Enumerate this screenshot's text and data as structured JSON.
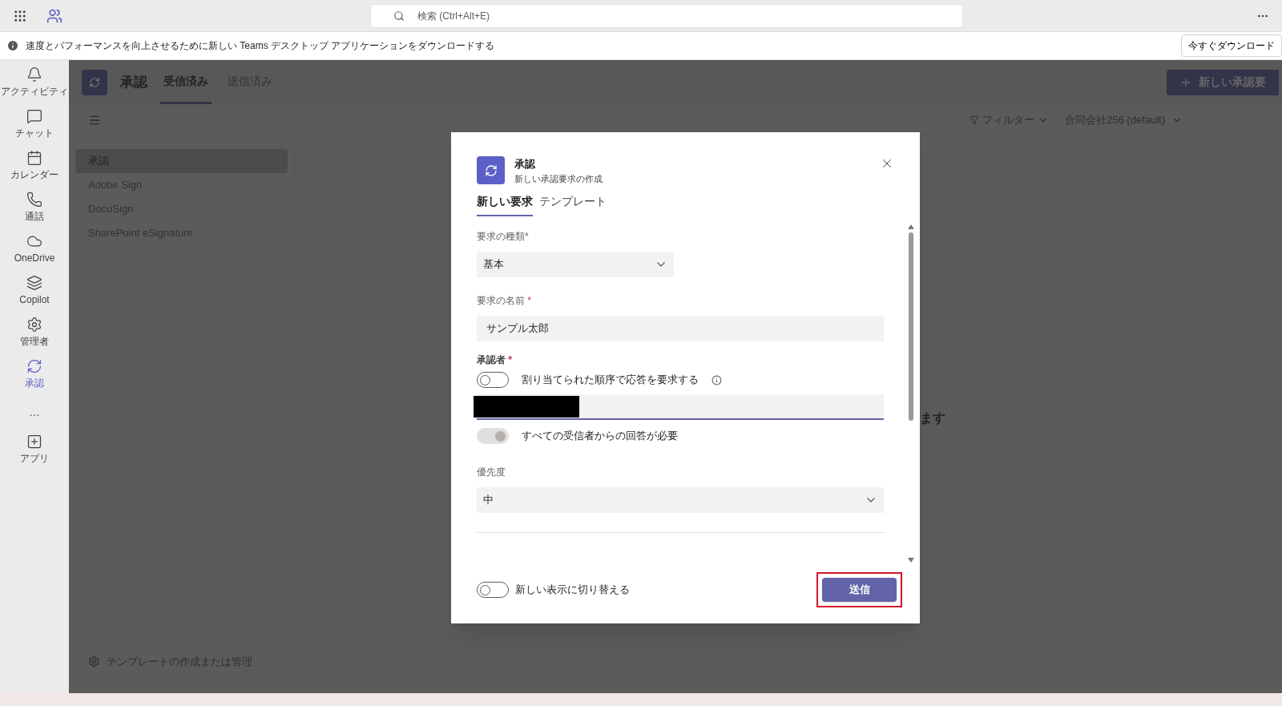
{
  "topbar": {
    "search": {
      "placeholder": "検索 (Ctrl+Alt+E)"
    }
  },
  "banner": {
    "text": "速度とパフォーマンスを向上させるために新しい Teams デスクトップ アプリケーションをダウンロードする",
    "button": "今すぐダウンロード"
  },
  "rail": [
    {
      "label": "アクティビティ",
      "selected": false
    },
    {
      "label": "チャット",
      "selected": false
    },
    {
      "label": "カレンダー",
      "selected": false
    },
    {
      "label": "通話",
      "selected": false
    },
    {
      "label": "OneDrive",
      "selected": false
    },
    {
      "label": "Copilot",
      "selected": false
    },
    {
      "label": "管理者",
      "selected": false
    },
    {
      "label": "承認",
      "selected": true
    },
    {
      "label": "…",
      "kind": "more",
      "selected": false
    },
    {
      "label": "アプリ",
      "selected": false
    }
  ],
  "app_header": {
    "title": "承認",
    "tabs": [
      {
        "label": "受信済み",
        "selected": true
      },
      {
        "label": "送信済み",
        "selected": false
      }
    ],
    "new_button": "新しい承認要"
  },
  "left_panel": {
    "items": [
      {
        "label": "承認",
        "selected": true
      },
      {
        "label": "Adobe Sign",
        "selected": false
      },
      {
        "label": "DocuSign",
        "selected": false
      },
      {
        "label": "SharePoint eSignature",
        "selected": false
      }
    ],
    "footer": "テンプレートの作成または管理"
  },
  "toolbar": {
    "filter": "フィルター",
    "org": "合同会社256 (default)"
  },
  "background_text": "ます",
  "dialog": {
    "title": "承認",
    "subtitle": "新しい承認要求の作成",
    "tabs": [
      {
        "label": "新しい要求",
        "selected": true
      },
      {
        "label": "テンプレート",
        "selected": false
      }
    ],
    "request_type": {
      "label": "要求の種類*",
      "value": "基本"
    },
    "request_name": {
      "label": "要求の名前",
      "required_mark": "*",
      "value": "サンプル太郎"
    },
    "approvers": {
      "label": "承認者",
      "required_mark": "*",
      "order_toggle": {
        "label": "割り当てられた順序で応答を要求する",
        "on": false
      },
      "all_toggle": {
        "label": "すべての受信者からの回答が必要",
        "on": true,
        "disabled": true
      }
    },
    "priority": {
      "label": "優先度",
      "value": "中"
    },
    "switch_view": {
      "label": "新しい表示に切り替える",
      "on": false
    },
    "submit": "送信"
  }
}
